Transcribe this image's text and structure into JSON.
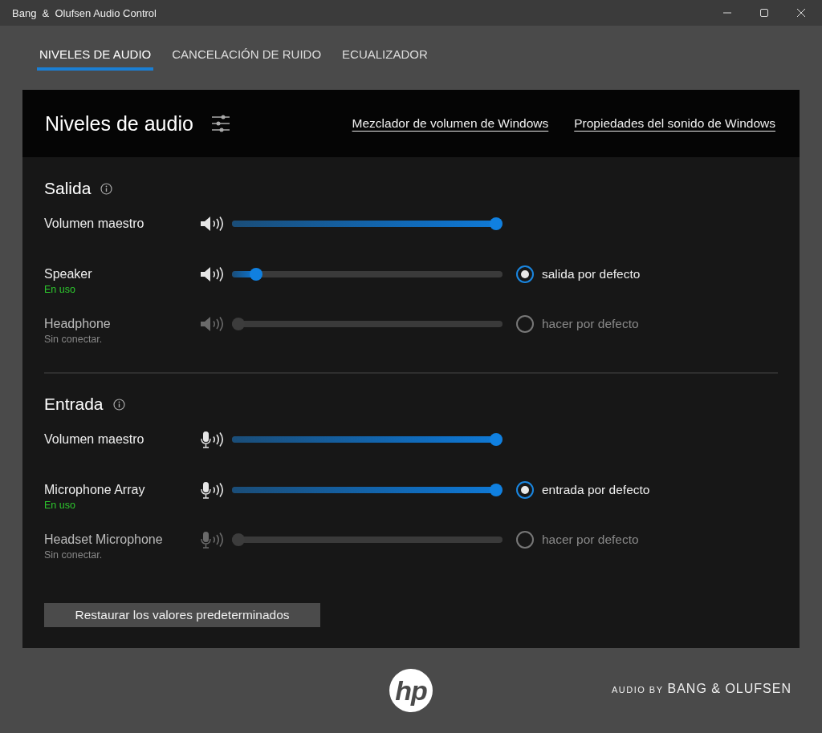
{
  "window": {
    "title": "Bang  &  Olufsen Audio Control"
  },
  "tabs": [
    {
      "label": "NIVELES DE AUDIO",
      "selected": true
    },
    {
      "label": "CANCELACIÓN DE RUIDO",
      "selected": false
    },
    {
      "label": "ECUALIZADOR",
      "selected": false
    }
  ],
  "panel": {
    "title": "Niveles de audio",
    "links": [
      "Mezclador de volumen de Windows",
      "Propiedades del sonido de Windows"
    ]
  },
  "sections": [
    {
      "title": "Salida",
      "kind": "speaker",
      "rows": [
        {
          "kind": "master",
          "name": "Volumen maestro",
          "level": 1.0
        },
        {
          "kind": "device",
          "name": "Speaker",
          "status": "En uso",
          "connected": true,
          "level": 0.07,
          "default": {
            "label": "salida por defecto",
            "selected": true
          }
        },
        {
          "kind": "device",
          "name": "Headphone",
          "status": "Sin conectar.",
          "connected": false,
          "level": 0,
          "default": {
            "label": "hacer por defecto",
            "selected": false
          }
        }
      ]
    },
    {
      "title": "Entrada",
      "kind": "microphone",
      "rows": [
        {
          "kind": "master",
          "name": "Volumen maestro",
          "level": 1.0
        },
        {
          "kind": "device",
          "name": "Microphone Array",
          "status": "En uso",
          "connected": true,
          "level": 1.0,
          "default": {
            "label": "entrada por defecto",
            "selected": true
          }
        },
        {
          "kind": "device",
          "name": "Headset Microphone",
          "status": "Sin conectar.",
          "connected": false,
          "level": 0,
          "default": {
            "label": "hacer por defecto",
            "selected": false
          }
        }
      ]
    }
  ],
  "reset_button": "Restaurar los valores predeterminados",
  "footer": {
    "logo_text": "hp",
    "brand_prefix": "AUDIO BY",
    "brand": "BANG & OLUFSEN"
  }
}
